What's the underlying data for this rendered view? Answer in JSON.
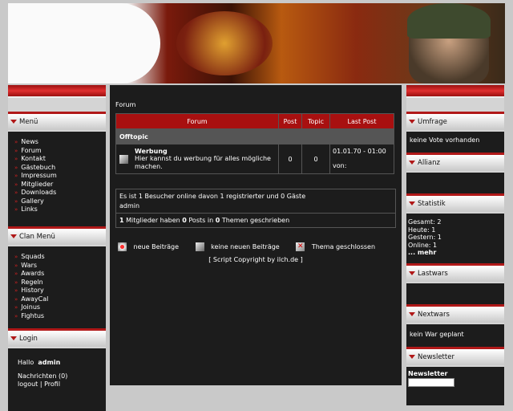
{
  "left": {
    "menu_title": "Menü",
    "menu": [
      "News",
      "Forum",
      "Kontakt",
      "Gästebuch",
      "Impressum",
      "Mitglieder",
      "Downloads",
      "Gallery",
      "Links"
    ],
    "clan_title": "Clan Menü",
    "clan": [
      "Squads",
      "Wars",
      "Awards",
      "Regeln",
      "History",
      "AwayCal",
      "Joinus",
      "Fightus"
    ],
    "login_title": "Login",
    "hallo": "Hallo",
    "user": "admin",
    "messages": "Nachrichten (0)",
    "logout": "logout",
    "sep": "|",
    "profil": "Profil"
  },
  "main": {
    "breadcrumb": "Forum",
    "headers": {
      "forum": "Forum",
      "post": "Post",
      "topic": "Topic",
      "last": "Last Post"
    },
    "category": "Offtopic",
    "board": {
      "title": "Werbung",
      "desc": "Hier kannst du werbung für alles mögliche machen.",
      "posts": "0",
      "topics": "0",
      "last_date": "01.01.70 - 01:00",
      "last_by": "von:"
    },
    "online": "Es ist 1 Besucher online davon 1 registrierter und 0 Gäste",
    "online_user": "admin",
    "stats": {
      "members": "1",
      "t1": "Mitglieder haben",
      "posts": "0",
      "t2": "Posts in",
      "themes": "0",
      "t3": "Themen geschrieben"
    },
    "legend": {
      "new": "neue Beiträge",
      "none": "keine neuen Beiträge",
      "closed": "Thema geschlossen"
    },
    "copyright": "[ Script Copyright by ilch.de ]"
  },
  "right": {
    "umfrage_title": "Umfrage",
    "umfrage": "keine Vote vorhanden",
    "allianz_title": "Allianz",
    "statistik_title": "Statistik",
    "stats": [
      "Gesamt: 2",
      "Heute: 1",
      "Gestern: 1",
      "Online: 1"
    ],
    "mehr": "... mehr",
    "lastwars_title": "Lastwars",
    "nextwars_title": "Nextwars",
    "nextwars": "kein War geplant",
    "newsletter_title": "Newsletter",
    "newsletter_label": "Newsletter"
  },
  "colors": {
    "accent": "#b01818",
    "header_red": "#a81010",
    "panel": "#1c1c1c"
  }
}
